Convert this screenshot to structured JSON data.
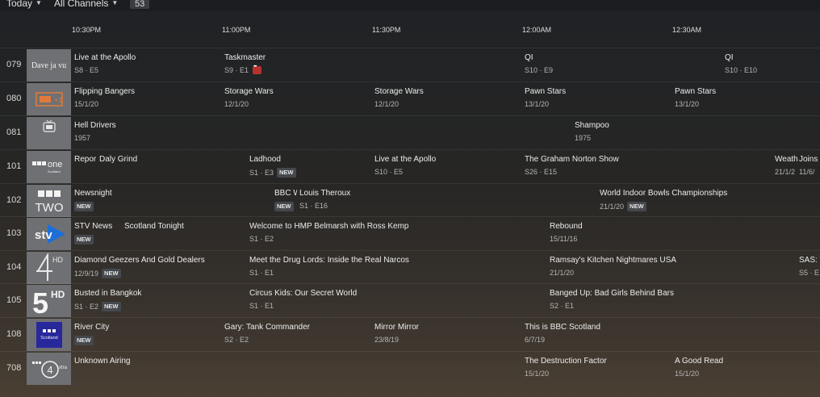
{
  "header": {
    "day_filter": "Today",
    "channel_filter": "All Channels",
    "channel_count": "53"
  },
  "time_slots": [
    "10:30PM",
    "11:00PM",
    "11:30PM",
    "12:00AM",
    "12:30AM"
  ],
  "channels": [
    {
      "number": "079",
      "logo": "Dave ja vu",
      "programs": [
        {
          "title": "Live at the Apollo",
          "subtitle": "S8 · E5"
        },
        {
          "title": "Taskmaster",
          "subtitle": "S9 · E1",
          "recording": true
        },
        {
          "title": "QI",
          "subtitle": "S10 · E9"
        },
        {
          "title": "QI",
          "subtitle": "S10 · E10"
        }
      ]
    },
    {
      "number": "080",
      "logo": "Quest+1",
      "programs": [
        {
          "title": "Flipping Bangers",
          "subtitle": "15/1/20"
        },
        {
          "title": "Storage Wars",
          "subtitle": "12/1/20"
        },
        {
          "title": "Storage Wars",
          "subtitle": "12/1/20"
        },
        {
          "title": "Pawn Stars",
          "subtitle": "13/1/20"
        },
        {
          "title": "Pawn Stars",
          "subtitle": "13/1/20"
        }
      ]
    },
    {
      "number": "081",
      "logo": "Talking Pictures TV",
      "programs": [
        {
          "title": "Hell Drivers",
          "subtitle": "1957"
        },
        {
          "title": "Shampoo",
          "subtitle": "1975"
        }
      ]
    },
    {
      "number": "101",
      "logo": "BBC one Scotland",
      "programs": [
        {
          "title": "Repor",
          "subtitle": ""
        },
        {
          "title": "Daly Grind",
          "subtitle": ""
        },
        {
          "title": "Ladhood",
          "subtitle": "S1 · E3",
          "new": true
        },
        {
          "title": "Live at the Apollo",
          "subtitle": "S10 · E5"
        },
        {
          "title": "The Graham Norton Show",
          "subtitle": "S26 · E15"
        },
        {
          "title": "Weath",
          "subtitle": "21/1/2"
        },
        {
          "title": "Joins",
          "subtitle": "11/6/"
        }
      ]
    },
    {
      "number": "102",
      "logo": "BBC TWO",
      "programs": [
        {
          "title": "Newsnight",
          "subtitle": "",
          "new": true
        },
        {
          "title": "BBC W",
          "subtitle": "",
          "new": true
        },
        {
          "title": "Louis Theroux",
          "subtitle": "S1 · E16"
        },
        {
          "title": "World Indoor Bowls Championships",
          "subtitle": "21/1/20",
          "new": true
        }
      ]
    },
    {
      "number": "103",
      "logo": "STV",
      "programs": [
        {
          "title": "STV News",
          "subtitle": "",
          "new": true
        },
        {
          "title": "Scotland Tonight",
          "subtitle": ""
        },
        {
          "title": "Welcome to HMP Belmarsh with Ross Kemp",
          "subtitle": "S1 · E2"
        },
        {
          "title": "Rebound",
          "subtitle": "15/11/16"
        }
      ]
    },
    {
      "number": "104",
      "logo": "4 HD",
      "programs": [
        {
          "title": "Diamond Geezers And Gold Dealers",
          "subtitle": "12/9/19",
          "new": true
        },
        {
          "title": "Meet the Drug Lords: Inside the Real Narcos",
          "subtitle": "S1 · E1"
        },
        {
          "title": "Ramsay's Kitchen Nightmares USA",
          "subtitle": "21/1/20"
        },
        {
          "title": "SAS: W",
          "subtitle": "S5 · E"
        }
      ]
    },
    {
      "number": "105",
      "logo": "5 HD",
      "programs": [
        {
          "title": "Busted in Bangkok",
          "subtitle": "S1 · E2",
          "new": true
        },
        {
          "title": "Circus Kids: Our Secret World",
          "subtitle": "S1 · E1"
        },
        {
          "title": "Banged Up: Bad Girls Behind Bars",
          "subtitle": "S2 · E1"
        }
      ]
    },
    {
      "number": "108",
      "logo": "BBC Scotland",
      "programs": [
        {
          "title": "River City",
          "subtitle": "",
          "new": true
        },
        {
          "title": "Gary: Tank Commander",
          "subtitle": "S2 · E2"
        },
        {
          "title": "Mirror Mirror",
          "subtitle": "23/8/19"
        },
        {
          "title": "This is BBC Scotland",
          "subtitle": "6/7/19"
        }
      ]
    },
    {
      "number": "708",
      "logo": "BBC Radio 4 extra",
      "programs": [
        {
          "title": "Unknown Airing",
          "subtitle": ""
        },
        {
          "title": "The Destruction Factor",
          "subtitle": "15/1/20"
        },
        {
          "title": "A Good Read",
          "subtitle": "15/1/20"
        }
      ]
    }
  ],
  "colors": {
    "new_badge": "#45484c",
    "record_badge": "#b8312b",
    "logo_tile": "#6f7073"
  }
}
